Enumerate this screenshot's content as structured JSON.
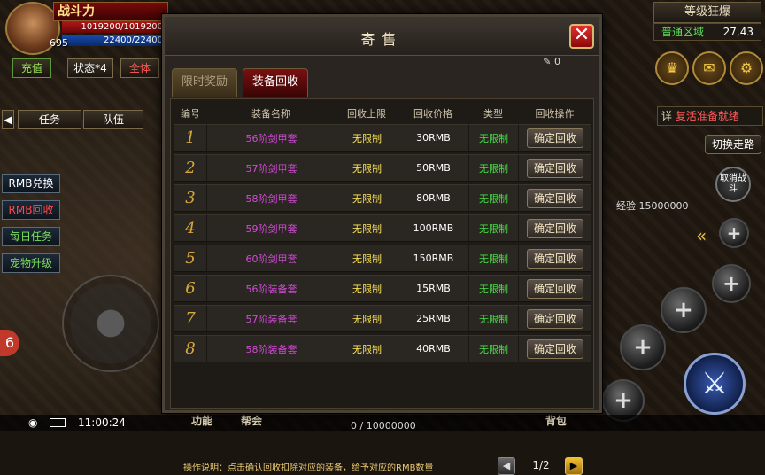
{
  "player": {
    "name": "战斗力",
    "level": "695",
    "hp": "1019200/1019200",
    "mp": "22400/22400"
  },
  "topbar": {
    "recharge": "充值",
    "status": "状态*4",
    "all": "全体"
  },
  "nav": {
    "task": "任务",
    "team": "队伍"
  },
  "side_menu": [
    "RMB兑换",
    "RMB回收",
    "每日任务",
    "宠物升级"
  ],
  "right_hud": {
    "rank_label": "等级狂爆",
    "region": "普通区域",
    "coords": "27,43",
    "ready": "复活准备就绪",
    "switch": "切换走路",
    "cancel_fight": "取消战斗",
    "exp": "经验 15000000",
    "exp_bar": "0 / 10000000"
  },
  "bottom": {
    "time": "11:00:24",
    "func": "功能",
    "guild": "帮会",
    "bag": "背包"
  },
  "dialog": {
    "title": "寄售",
    "close": "✕",
    "tabs": [
      "限时奖励",
      "装备回收"
    ],
    "count": "0",
    "columns": [
      "编号",
      "装备名称",
      "回收上限",
      "回收价格",
      "类型",
      "回收操作"
    ],
    "rows": [
      {
        "id": "1",
        "name": "56阶剑甲套",
        "limit": "无限制",
        "price": "30RMB",
        "type": "无限制",
        "action": "确定回收"
      },
      {
        "id": "2",
        "name": "57阶剑甲套",
        "limit": "无限制",
        "price": "50RMB",
        "type": "无限制",
        "action": "确定回收"
      },
      {
        "id": "3",
        "name": "58阶剑甲套",
        "limit": "无限制",
        "price": "80RMB",
        "type": "无限制",
        "action": "确定回收"
      },
      {
        "id": "4",
        "name": "59阶剑甲套",
        "limit": "无限制",
        "price": "100RMB",
        "type": "无限制",
        "action": "确定回收"
      },
      {
        "id": "5",
        "name": "60阶剑甲套",
        "limit": "无限制",
        "price": "150RMB",
        "type": "无限制",
        "action": "确定回收"
      },
      {
        "id": "6",
        "name": "56阶装备套",
        "limit": "无限制",
        "price": "15RMB",
        "type": "无限制",
        "action": "确定回收"
      },
      {
        "id": "7",
        "name": "57阶装备套",
        "limit": "无限制",
        "price": "25RMB",
        "type": "无限制",
        "action": "确定回收"
      },
      {
        "id": "8",
        "name": "58阶装备套",
        "limit": "无限制",
        "price": "40RMB",
        "type": "无限制",
        "action": "确定回收"
      }
    ],
    "note": "操作说明：点击确认回收扣除对应的装备，给予对应的RMB数量",
    "page": "1/2"
  },
  "icons": [
    "trophy-icon",
    "mail-icon",
    "gear-icon",
    "plus-icon",
    "sword-icon"
  ]
}
